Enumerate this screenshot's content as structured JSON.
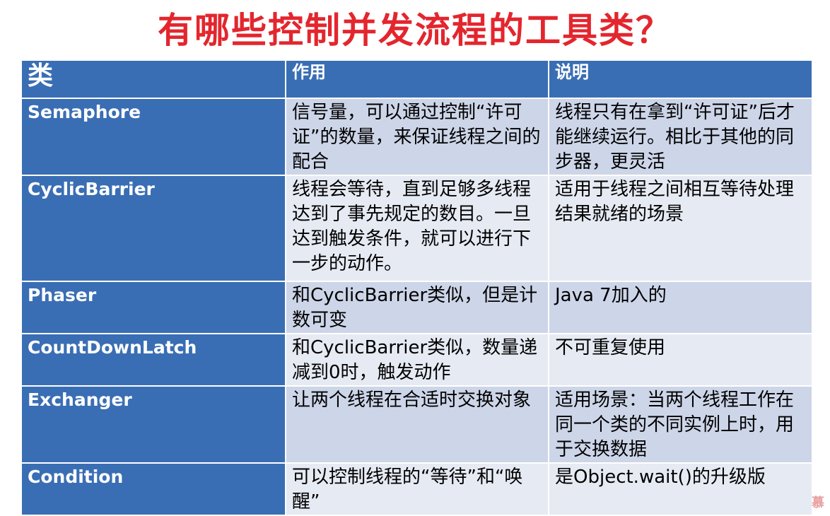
{
  "title": "有哪些控制并发流程的工具类？",
  "table": {
    "headers": [
      "类",
      "作用",
      "说明"
    ],
    "rows": [
      {
        "name": "Semaphore",
        "purpose": "信号量，可以通过控制“许可证”的数量，来保证线程之间的配合",
        "note": "线程只有在拿到“许可证”后才能继续运行。相比于其他的同步器，更灵活"
      },
      {
        "name": "CyclicBarrier",
        "purpose": "线程会等待，直到足够多线程达到了事先规定的数目。一旦达到触发条件，就可以进行下一步的动作。",
        "note": "适用于线程之间相互等待处理结果就绪的场景"
      },
      {
        "name": "Phaser",
        "purpose": "和CyclicBarrier类似，但是计数可变",
        "note": "Java 7加入的"
      },
      {
        "name": "CountDownLatch",
        "purpose": "和CyclicBarrier类似，数量递减到0时，触发动作",
        "note": "不可重复使用"
      },
      {
        "name": "Exchanger",
        "purpose": "让两个线程在合适时交换对象",
        "note": "适用场景：当两个线程工作在同一个类的不同实例上时，用于交换数据"
      },
      {
        "name": "Condition",
        "purpose": "可以控制线程的“等待”和“唤醒”",
        "note": "是Object.wait()的升级版"
      }
    ]
  },
  "watermark": "慕",
  "colors": {
    "title": "#e3262e",
    "header_bg": "#3a6eb4",
    "row_odd_bg": "#cdd5e8",
    "row_even_bg": "#e6eaf3"
  },
  "icons": {
    "watermark": "flame-logo-icon"
  }
}
